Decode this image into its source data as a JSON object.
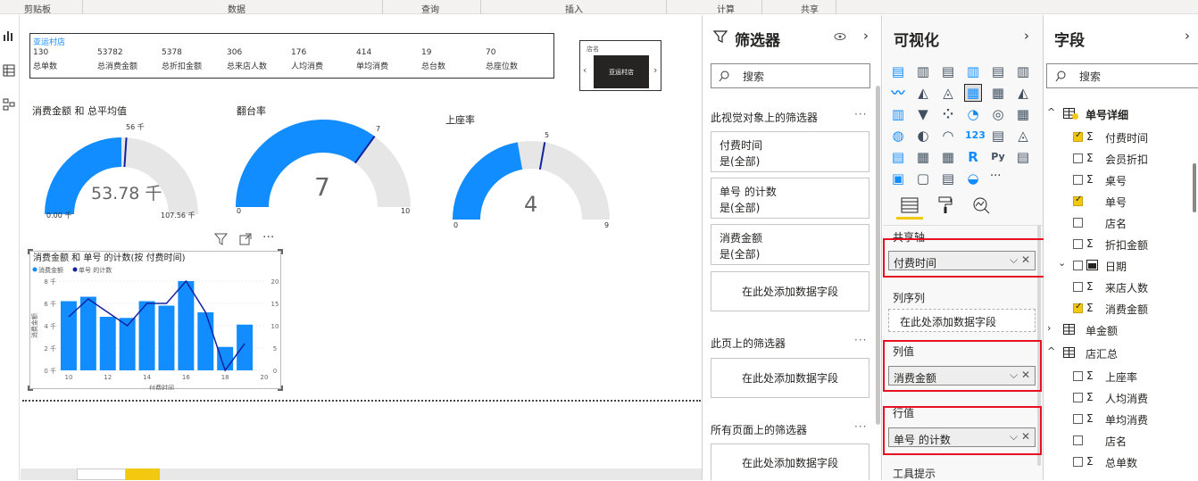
{
  "ribbon": {
    "groups": [
      "剪贴板",
      "数据",
      "查询",
      "插入",
      "计算",
      "共享"
    ]
  },
  "kpi": {
    "title": "亚运村店",
    "items": [
      {
        "value": "130",
        "label": "总单数"
      },
      {
        "value": "53782",
        "label": "总消费金额"
      },
      {
        "value": "5378",
        "label": "总折扣金额"
      },
      {
        "value": "306",
        "label": "总来店人数"
      },
      {
        "value": "176",
        "label": "人均消费"
      },
      {
        "value": "414",
        "label": "单均消费"
      },
      {
        "value": "19",
        "label": "总台数"
      },
      {
        "value": "70",
        "label": "总座位数"
      }
    ]
  },
  "slicer": {
    "title": "店名",
    "value": "亚运村店"
  },
  "gauges": [
    {
      "title": "消费金额 和 总平均值",
      "value_label": "53.78 千",
      "min_label": "0.00 千",
      "max_label": "107.56 千",
      "target_label": "56 千",
      "value": 53.78,
      "min": 0,
      "max": 107.56,
      "target": 56,
      "color": "#118dff"
    },
    {
      "title": "翻台率",
      "value_label": "7",
      "min_label": "0",
      "max_label": "10",
      "target_label": "7",
      "value": 7,
      "min": 0,
      "max": 10,
      "target": 7,
      "color": "#118dff"
    },
    {
      "title": "上座率",
      "value_label": "4",
      "min_label": "0",
      "max_label": "9",
      "target_label": "5",
      "value": 4,
      "min": 0,
      "max": 9,
      "target": 5,
      "color": "#118dff"
    }
  ],
  "chart_data": {
    "type": "bar",
    "title": "消费金额 和 单号 的计数(按 付费时间)",
    "xlabel": "付费时间",
    "ylabel": "消费金额",
    "legend": [
      "消费金额",
      "单号 的计数"
    ],
    "x": [
      10,
      11,
      12,
      13,
      14,
      15,
      16,
      17,
      18,
      19
    ],
    "bars": [
      6.2,
      6.6,
      4.8,
      4.7,
      6.2,
      5.8,
      8.0,
      5.2,
      2.1,
      4.1
    ],
    "line": [
      12,
      16,
      13,
      10,
      15,
      15,
      20,
      13,
      0,
      6
    ],
    "y_left_ticks": [
      "0 千",
      "2 千",
      "4 千",
      "6 千",
      "8 千"
    ],
    "y_right_ticks": [
      "0",
      "5",
      "10",
      "15",
      "20"
    ],
    "x_ticks": [
      "10",
      "12",
      "14",
      "16",
      "18",
      "20"
    ],
    "ylim_left": [
      0,
      8
    ],
    "ylim_right": [
      0,
      20
    ],
    "xlim": [
      9.5,
      20
    ],
    "bar_color": "#118dff",
    "line_color": "#12239e"
  },
  "filters": {
    "title": "筛选器",
    "search_placeholder": "搜索",
    "section_visual": "此视觉对象上的筛选器",
    "cards": [
      {
        "name": "付费时间",
        "state": "是(全部)"
      },
      {
        "name": "单号 的计数",
        "state": "是(全部)"
      },
      {
        "name": "消费金额",
        "state": "是(全部)"
      }
    ],
    "add_label": "在此处添加数据字段",
    "section_page": "此页上的筛选器",
    "section_all": "所有页面上的筛选器"
  },
  "viz": {
    "title": "可视化",
    "more_label": "···",
    "shared_axis": "共享轴",
    "shared_axis_value": "付费时间",
    "column_series": "列序列",
    "column_series_add": "在此处添加数据字段",
    "column_values": "列值",
    "column_values_value": "消费金额",
    "line_values": "行值",
    "line_values_value": "单号 的计数",
    "tooltips": "工具提示"
  },
  "fields": {
    "title": "字段",
    "search_placeholder": "搜索",
    "tables": [
      {
        "name": "单号详细",
        "items": [
          {
            "name": "付费时间",
            "sigma": true,
            "checked": true
          },
          {
            "name": "会员折扣",
            "sigma": true,
            "checked": false
          },
          {
            "name": "桌号",
            "sigma": true,
            "checked": false
          },
          {
            "name": "单号",
            "sigma": false,
            "checked": true
          },
          {
            "name": "店名",
            "sigma": false,
            "checked": false
          },
          {
            "name": "折扣金额",
            "sigma": true,
            "checked": false
          },
          {
            "name": "日期",
            "sigma": false,
            "checked": false
          },
          {
            "name": "来店人数",
            "sigma": true,
            "checked": false
          },
          {
            "name": "消费金额",
            "sigma": true,
            "checked": true
          }
        ]
      },
      {
        "name": "单金额",
        "items": []
      },
      {
        "name": "店汇总",
        "items": [
          {
            "name": "上座率",
            "sigma": true,
            "checked": false
          },
          {
            "name": "人均消费",
            "sigma": true,
            "checked": false
          },
          {
            "name": "单均消费",
            "sigma": true,
            "checked": false
          },
          {
            "name": "店名",
            "sigma": false,
            "checked": false
          },
          {
            "name": "总单数",
            "sigma": true,
            "checked": false
          }
        ]
      }
    ]
  }
}
